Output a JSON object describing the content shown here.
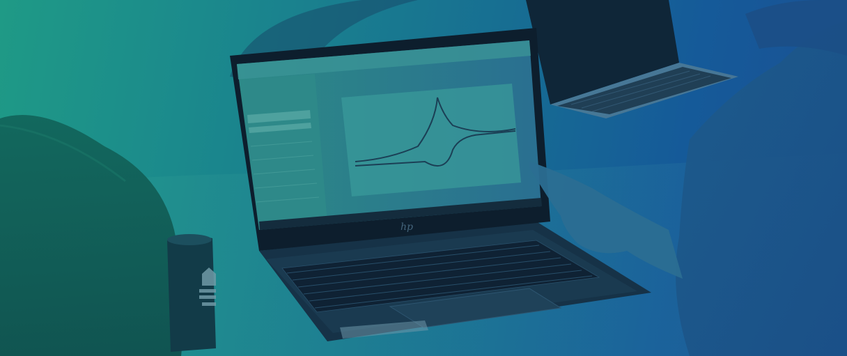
{
  "scene": {
    "description_tag": "photo",
    "main_device": "laptop",
    "laptop_brand_mark": "hp",
    "screen_app": "electrochemistry-software",
    "screen_plot": "cyclic-voltammogram",
    "secondary_device": "laptop",
    "mug_logo": "logo",
    "colors": {
      "overlay_left": "#1f9a86",
      "overlay_right": "#1c4f93",
      "screen_plot_line": "#1b3f55"
    }
  }
}
